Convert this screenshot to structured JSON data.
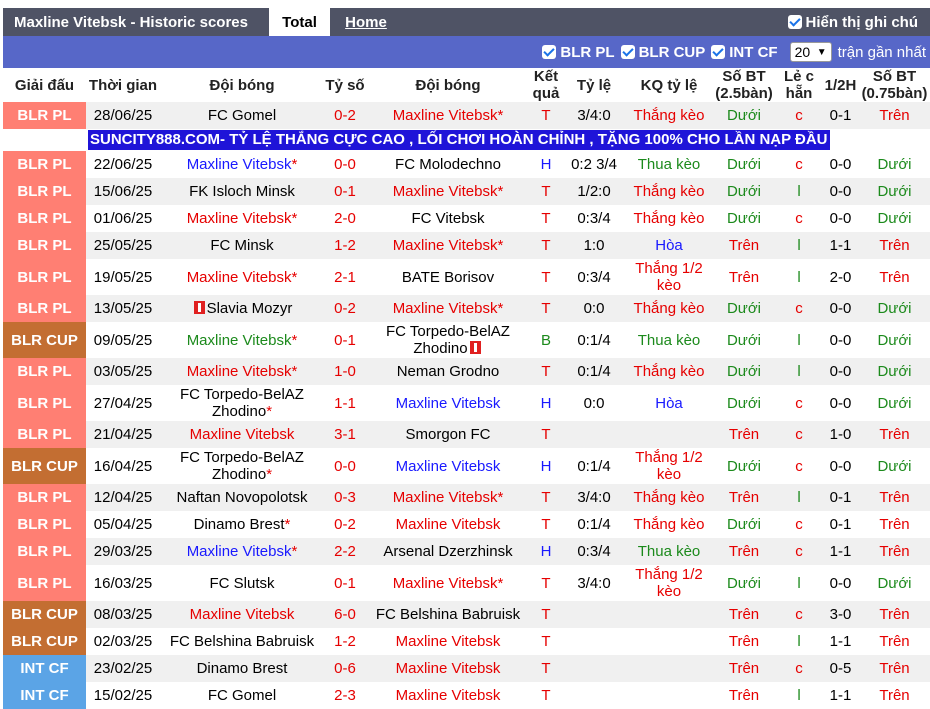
{
  "header": {
    "title": "Maxline Vitebsk - Historic scores",
    "tab_total": "Total",
    "tab_home": "Home",
    "show_label": "Hiển thị ghi chú"
  },
  "filters": {
    "items": [
      "BLR PL",
      "BLR CUP",
      "INT CF"
    ],
    "select_value": "20",
    "recent_label": "trận gần nhất"
  },
  "columns": [
    "Giải đấu",
    "Thời gian",
    "Đội bóng",
    "Tỷ số",
    "Đội bóng",
    "Kết quả",
    "Tỷ lệ",
    "KQ tỷ lệ",
    "Số BT (2.5bàn)",
    "Lẻ c hẵn",
    "1/2H",
    "Số BT (0.75bàn)"
  ],
  "ad_text": "SUNCITY888.COM- TỶ LỆ THẮNG CỰC CAO , LỐI CHƠI HOÀN CHỈNH , TẶNG 100% CHO LẦN NẠP ĐẦU",
  "colors": {
    "blr_pl": "#ff7f73",
    "blr_cup": "#c36e32",
    "int_cf": "#5ba4e6",
    "red": "#e60000",
    "blue": "#1919ff",
    "green": "#1c8a1c"
  },
  "rows": [
    {
      "league": "BLR PL",
      "date": "28/06/25",
      "home": "FC Gomel",
      "home_star": "",
      "home_c": "",
      "score": "0-2",
      "away": "Maxline Vitebsk",
      "away_star": "*",
      "away_c": "red",
      "res": "T",
      "res_c": "red",
      "odds": "3/4:0",
      "kq": "Thắng kèo",
      "kq_c": "red",
      "bt": "Dưới",
      "bt_c": "green",
      "oe": "c",
      "oe_c": "red",
      "half": "0-1",
      "bt2": "Trên",
      "bt2_c": "red"
    },
    {
      "league": "BLR PL",
      "date": "22/06/25",
      "home": "Maxline Vitebsk",
      "home_star": "*",
      "home_c": "blue",
      "score": "0-0",
      "away": "FC Molodechno",
      "away_star": "",
      "away_c": "",
      "res": "H",
      "res_c": "blue",
      "odds": "0:2 3/4",
      "kq": "Thua kèo",
      "kq_c": "green",
      "bt": "Dưới",
      "bt_c": "green",
      "oe": "c",
      "oe_c": "red",
      "half": "0-0",
      "bt2": "Dưới",
      "bt2_c": "green"
    },
    {
      "league": "BLR PL",
      "date": "15/06/25",
      "home": "FK Isloch Minsk",
      "home_star": "",
      "home_c": "",
      "score": "0-1",
      "away": "Maxline Vitebsk",
      "away_star": "*",
      "away_c": "red",
      "res": "T",
      "res_c": "red",
      "odds": "1/2:0",
      "kq": "Thắng kèo",
      "kq_c": "red",
      "bt": "Dưới",
      "bt_c": "green",
      "oe": "l",
      "oe_c": "green",
      "half": "0-0",
      "bt2": "Dưới",
      "bt2_c": "green"
    },
    {
      "league": "BLR PL",
      "date": "01/06/25",
      "home": "Maxline Vitebsk",
      "home_star": "*",
      "home_c": "red",
      "score": "2-0",
      "away": "FC Vitebsk",
      "away_star": "",
      "away_c": "",
      "res": "T",
      "res_c": "red",
      "odds": "0:3/4",
      "kq": "Thắng kèo",
      "kq_c": "red",
      "bt": "Dưới",
      "bt_c": "green",
      "oe": "c",
      "oe_c": "red",
      "half": "0-0",
      "bt2": "Dưới",
      "bt2_c": "green"
    },
    {
      "league": "BLR PL",
      "date": "25/05/25",
      "home": "FC Minsk",
      "home_star": "",
      "home_c": "",
      "score": "1-2",
      "away": "Maxline Vitebsk",
      "away_star": "*",
      "away_c": "red",
      "res": "T",
      "res_c": "red",
      "odds": "1:0",
      "kq": "Hòa",
      "kq_c": "blue",
      "bt": "Trên",
      "bt_c": "red",
      "oe": "l",
      "oe_c": "green",
      "half": "1-1",
      "bt2": "Trên",
      "bt2_c": "red"
    },
    {
      "league": "BLR PL",
      "date": "19/05/25",
      "home": "Maxline Vitebsk",
      "home_star": "*",
      "home_c": "red",
      "score": "2-1",
      "away": "BATE Borisov",
      "away_star": "",
      "away_c": "",
      "res": "T",
      "res_c": "red",
      "odds": "0:3/4",
      "kq": "Thắng 1/2 kèo",
      "kq_c": "red",
      "bt": "Trên",
      "bt_c": "red",
      "oe": "l",
      "oe_c": "green",
      "half": "2-0",
      "bt2": "Trên",
      "bt2_c": "red"
    },
    {
      "league": "BLR PL",
      "date": "13/05/25",
      "home": "Slavia Mozyr",
      "home_star": "",
      "home_c": "",
      "home_flag": true,
      "score": "0-2",
      "away": "Maxline Vitebsk",
      "away_star": "*",
      "away_c": "red",
      "res": "T",
      "res_c": "red",
      "odds": "0:0",
      "kq": "Thắng kèo",
      "kq_c": "red",
      "bt": "Dưới",
      "bt_c": "green",
      "oe": "c",
      "oe_c": "red",
      "half": "0-0",
      "bt2": "Dưới",
      "bt2_c": "green"
    },
    {
      "league": "BLR CUP",
      "date": "09/05/25",
      "home": "Maxline Vitebsk",
      "home_star": "*",
      "home_c": "green",
      "score": "0-1",
      "away": "FC Torpedo-BelAZ Zhodino",
      "away_star": "",
      "away_c": "",
      "away_flag": true,
      "res": "B",
      "res_c": "green",
      "odds": "0:1/4",
      "kq": "Thua kèo",
      "kq_c": "green",
      "bt": "Dưới",
      "bt_c": "green",
      "oe": "l",
      "oe_c": "green",
      "half": "0-0",
      "bt2": "Dưới",
      "bt2_c": "green"
    },
    {
      "league": "BLR PL",
      "date": "03/05/25",
      "home": "Maxline Vitebsk",
      "home_star": "*",
      "home_c": "red",
      "score": "1-0",
      "away": "Neman Grodno",
      "away_star": "",
      "away_c": "",
      "res": "T",
      "res_c": "red",
      "odds": "0:1/4",
      "kq": "Thắng kèo",
      "kq_c": "red",
      "bt": "Dưới",
      "bt_c": "green",
      "oe": "l",
      "oe_c": "green",
      "half": "0-0",
      "bt2": "Dưới",
      "bt2_c": "green"
    },
    {
      "league": "BLR PL",
      "date": "27/04/25",
      "home": "FC Torpedo-BelAZ Zhodino",
      "home_star": "*",
      "home_c": "",
      "score": "1-1",
      "away": "Maxline Vitebsk",
      "away_star": "",
      "away_c": "blue",
      "res": "H",
      "res_c": "blue",
      "odds": "0:0",
      "kq": "Hòa",
      "kq_c": "blue",
      "bt": "Dưới",
      "bt_c": "green",
      "oe": "c",
      "oe_c": "red",
      "half": "0-0",
      "bt2": "Dưới",
      "bt2_c": "green"
    },
    {
      "league": "BLR PL",
      "date": "21/04/25",
      "home": "Maxline Vitebsk",
      "home_star": "",
      "home_c": "red",
      "score": "3-1",
      "away": "Smorgon FC",
      "away_star": "",
      "away_c": "",
      "res": "T",
      "res_c": "red",
      "odds": "",
      "kq": "",
      "kq_c": "",
      "bt": "Trên",
      "bt_c": "red",
      "oe": "c",
      "oe_c": "red",
      "half": "1-0",
      "bt2": "Trên",
      "bt2_c": "red"
    },
    {
      "league": "BLR CUP",
      "date": "16/04/25",
      "home": "FC Torpedo-BelAZ Zhodino",
      "home_star": "*",
      "home_c": "",
      "score": "0-0",
      "away": "Maxline Vitebsk",
      "away_star": "",
      "away_c": "blue",
      "res": "H",
      "res_c": "blue",
      "odds": "0:1/4",
      "kq": "Thắng 1/2 kèo",
      "kq_c": "red",
      "bt": "Dưới",
      "bt_c": "green",
      "oe": "c",
      "oe_c": "red",
      "half": "0-0",
      "bt2": "Dưới",
      "bt2_c": "green"
    },
    {
      "league": "BLR PL",
      "date": "12/04/25",
      "home": "Naftan Novopolotsk",
      "home_star": "",
      "home_c": "",
      "score": "0-3",
      "away": "Maxline Vitebsk",
      "away_star": "*",
      "away_c": "red",
      "res": "T",
      "res_c": "red",
      "odds": "3/4:0",
      "kq": "Thắng kèo",
      "kq_c": "red",
      "bt": "Trên",
      "bt_c": "red",
      "oe": "l",
      "oe_c": "green",
      "half": "0-1",
      "bt2": "Trên",
      "bt2_c": "red"
    },
    {
      "league": "BLR PL",
      "date": "05/04/25",
      "home": "Dinamo Brest",
      "home_star": "*",
      "home_c": "",
      "score": "0-2",
      "away": "Maxline Vitebsk",
      "away_star": "",
      "away_c": "red",
      "res": "T",
      "res_c": "red",
      "odds": "0:1/4",
      "kq": "Thắng kèo",
      "kq_c": "red",
      "bt": "Dưới",
      "bt_c": "green",
      "oe": "c",
      "oe_c": "red",
      "half": "0-1",
      "bt2": "Trên",
      "bt2_c": "red"
    },
    {
      "league": "BLR PL",
      "date": "29/03/25",
      "home": "Maxline Vitebsk",
      "home_star": "*",
      "home_c": "blue",
      "score": "2-2",
      "away": "Arsenal Dzerzhinsk",
      "away_star": "",
      "away_c": "",
      "res": "H",
      "res_c": "blue",
      "odds": "0:3/4",
      "kq": "Thua kèo",
      "kq_c": "green",
      "bt": "Trên",
      "bt_c": "red",
      "oe": "c",
      "oe_c": "red",
      "half": "1-1",
      "bt2": "Trên",
      "bt2_c": "red"
    },
    {
      "league": "BLR PL",
      "date": "16/03/25",
      "home": "FC Slutsk",
      "home_star": "",
      "home_c": "",
      "score": "0-1",
      "away": "Maxline Vitebsk",
      "away_star": "*",
      "away_c": "red",
      "res": "T",
      "res_c": "red",
      "odds": "3/4:0",
      "kq": "Thắng 1/2 kèo",
      "kq_c": "red",
      "bt": "Dưới",
      "bt_c": "green",
      "oe": "l",
      "oe_c": "green",
      "half": "0-0",
      "bt2": "Dưới",
      "bt2_c": "green"
    },
    {
      "league": "BLR CUP",
      "date": "08/03/25",
      "home": "Maxline Vitebsk",
      "home_star": "",
      "home_c": "red",
      "score": "6-0",
      "away": "FC Belshina Babruisk",
      "away_star": "",
      "away_c": "",
      "res": "T",
      "res_c": "red",
      "odds": "",
      "kq": "",
      "kq_c": "",
      "bt": "Trên",
      "bt_c": "red",
      "oe": "c",
      "oe_c": "red",
      "half": "3-0",
      "bt2": "Trên",
      "bt2_c": "red"
    },
    {
      "league": "BLR CUP",
      "date": "02/03/25",
      "home": "FC Belshina Babruisk",
      "home_star": "",
      "home_c": "",
      "score": "1-2",
      "away": "Maxline Vitebsk",
      "away_star": "",
      "away_c": "red",
      "res": "T",
      "res_c": "red",
      "odds": "",
      "kq": "",
      "kq_c": "",
      "bt": "Trên",
      "bt_c": "red",
      "oe": "l",
      "oe_c": "green",
      "half": "1-1",
      "bt2": "Trên",
      "bt2_c": "red"
    },
    {
      "league": "INT CF",
      "date": "23/02/25",
      "home": "Dinamo Brest",
      "home_star": "",
      "home_c": "",
      "score": "0-6",
      "away": "Maxline Vitebsk",
      "away_star": "",
      "away_c": "red",
      "res": "T",
      "res_c": "red",
      "odds": "",
      "kq": "",
      "kq_c": "",
      "bt": "Trên",
      "bt_c": "red",
      "oe": "c",
      "oe_c": "red",
      "half": "0-5",
      "bt2": "Trên",
      "bt2_c": "red"
    },
    {
      "league": "INT CF",
      "date": "15/02/25",
      "home": "FC Gomel",
      "home_star": "",
      "home_c": "",
      "score": "2-3",
      "away": "Maxline Vitebsk",
      "away_star": "",
      "away_c": "red",
      "res": "T",
      "res_c": "red",
      "odds": "",
      "kq": "",
      "kq_c": "",
      "bt": "Trên",
      "bt_c": "red",
      "oe": "l",
      "oe_c": "green",
      "half": "1-1",
      "bt2": "Trên",
      "bt2_c": "red"
    }
  ]
}
